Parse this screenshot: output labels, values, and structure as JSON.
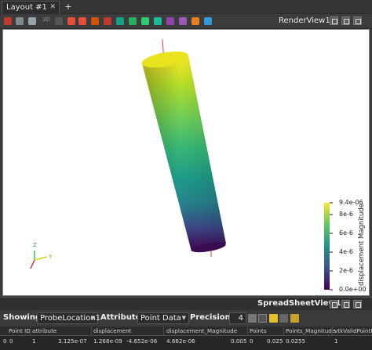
{
  "layout_tab": {
    "label": "Layout #1",
    "close": "✕",
    "add": "+"
  },
  "toolbar": {
    "small_label": "3D",
    "render_view_title": "RenderView1"
  },
  "render_view": {
    "colorbar": {
      "title": "displacement Magnitude",
      "ticks": [
        "9.4e-06",
        "8e-6",
        "6e-6",
        "4e-6",
        "2e-6",
        "0.0e+00"
      ]
    },
    "axes": {
      "z": "Z",
      "y": "Y"
    }
  },
  "spreadsheet": {
    "title": "SpreadSheetView1",
    "showing_label": "Showing",
    "showing_value": "ProbeLocation1",
    "attribute_label": "Attribute:",
    "attribute_value": "Point Data",
    "precision_label": "Precision:",
    "precision_value": "4",
    "columns": [
      "Point ID",
      "attribute",
      "displacement",
      "",
      "",
      "displacement_Magnitude",
      "Points",
      "",
      "Points_Magnitude",
      "vtkValidPointM..."
    ],
    "row": [
      "0",
      "0",
      "1",
      "3.125e-07",
      "1.268e-09",
      "-4.652e-06",
      "4.662e-06",
      "0.005",
      "0",
      "0.025",
      "0.0255",
      "1"
    ]
  },
  "colors": {
    "viridis_top": "#fde725",
    "viridis_bottom": "#440154",
    "accent": "#2a82da"
  }
}
